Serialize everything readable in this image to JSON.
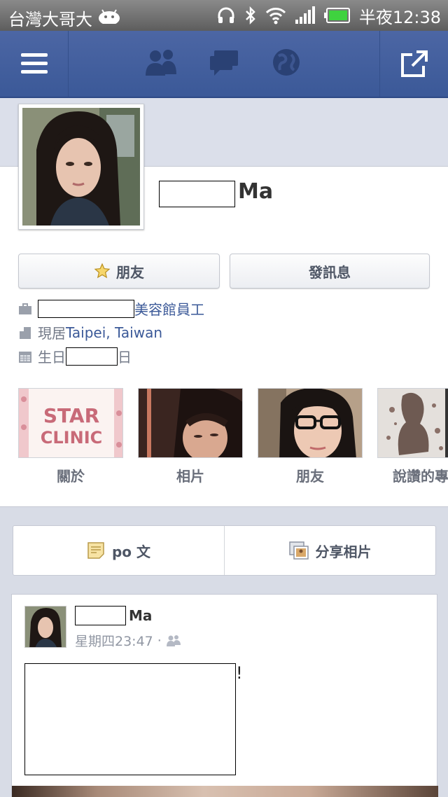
{
  "status_bar": {
    "carrier": "台灣大哥大",
    "clock": "半夜12:38"
  },
  "navbar": {
    "icons": [
      "menu-icon",
      "friend-requests-icon",
      "messages-icon",
      "notifications-globe-icon",
      "share-icon"
    ]
  },
  "profile": {
    "name_suffix": "Ma",
    "buttons": {
      "friend": "朋友",
      "message": "發訊息"
    },
    "info": {
      "work_suffix": "美容館員工",
      "lives_label": "現居 ",
      "lives_value": "Taipei, Taiwan",
      "birthday_label": "生日 ",
      "birthday_suffix": "日"
    },
    "tiles": [
      {
        "label": "關於",
        "image_text_1": "STAR",
        "image_text_2": "CLINIC"
      },
      {
        "label": "相片"
      },
      {
        "label": "朋友"
      },
      {
        "label": "說讚的專"
      }
    ]
  },
  "composer": {
    "post_label": "po 文",
    "share_photo_label": "分享相片"
  },
  "post": {
    "name_suffix": "Ma",
    "timestamp": "星期四23:47",
    "separator": "·",
    "body_suffix": "!"
  },
  "colors": {
    "brand_blue": "#3b5998",
    "navbar_top": "#4c66a4",
    "page_bg": "#d8dce6"
  }
}
